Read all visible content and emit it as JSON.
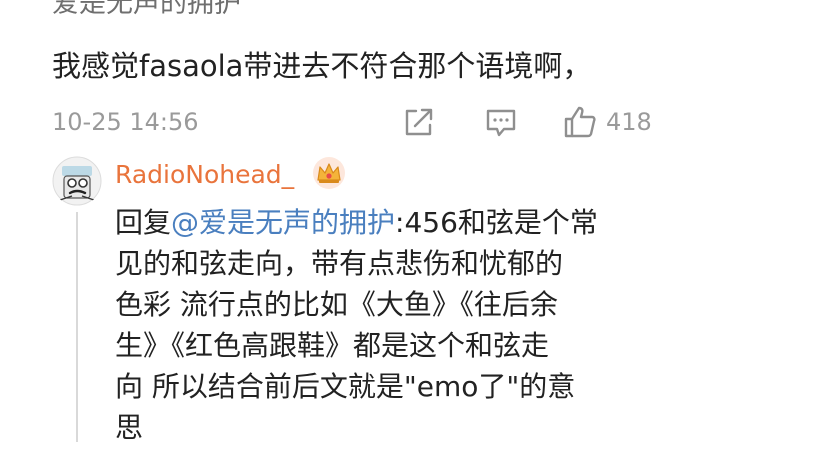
{
  "comment": {
    "author": "爱是无声的拥护",
    "text": "我感觉fasaola带进去不符合那个语境啊，",
    "timestamp": "10-25 14:56",
    "like_count": "418",
    "icons": [
      "share-icon",
      "comment-icon",
      "like-icon"
    ]
  },
  "reply": {
    "username": "RadioNohead_",
    "badge_icon": "crown-icon",
    "prefix": "回复",
    "mention": "@爱是无声的拥护",
    "first_line_rest": ":456和弦是个常",
    "lines": [
      "见的和弦走向，带有点悲伤和忧郁的",
      "色彩 流行点的比如《大鱼》《往后余",
      "生》《红色高跟鞋》都是这个和弦走",
      "向 所以结合前后文就是\"emo了\"的意",
      "思"
    ]
  },
  "colors": {
    "username": "#e9743c",
    "mention": "#4a7fbf",
    "meta": "#9a9a9a"
  }
}
